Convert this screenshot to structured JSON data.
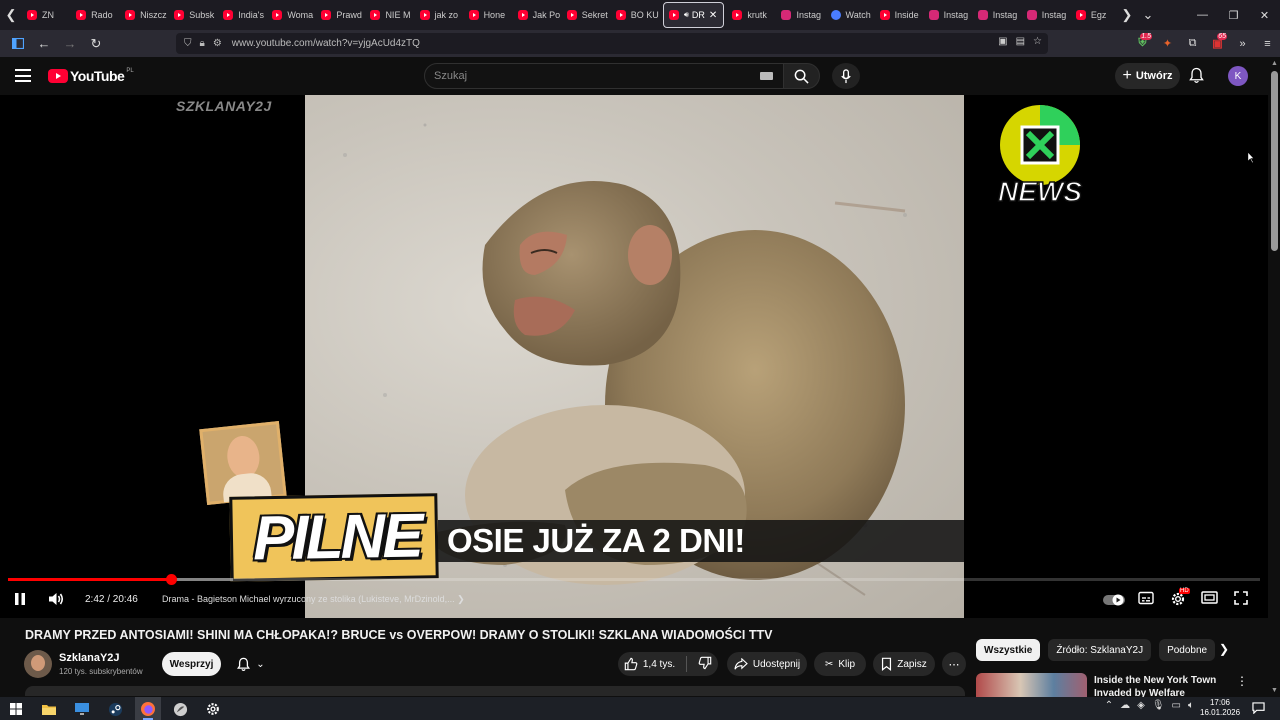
{
  "browser": {
    "tabs": [
      {
        "label": "ZN",
        "icon": "youtube-favicon"
      },
      {
        "label": "Rado",
        "icon": "youtube-favicon"
      },
      {
        "label": "Niszcz",
        "icon": "youtube-favicon"
      },
      {
        "label": "Subsk",
        "icon": "youtube-favicon"
      },
      {
        "label": "India's",
        "icon": "youtube-favicon"
      },
      {
        "label": "Woma",
        "icon": "youtube-favicon"
      },
      {
        "label": "Prawd",
        "icon": "youtube-favicon"
      },
      {
        "label": "NIE M",
        "icon": "youtube-favicon"
      },
      {
        "label": "jak zo",
        "icon": "youtube-favicon"
      },
      {
        "label": "Hone",
        "icon": "youtube-favicon"
      },
      {
        "label": "Jak Po",
        "icon": "youtube-favicon"
      },
      {
        "label": "Sekret",
        "icon": "youtube-favicon"
      },
      {
        "label": "BO KU",
        "icon": "youtube-favicon"
      },
      {
        "label": "DR",
        "icon": "youtube-favicon",
        "active": true
      },
      {
        "label": "krutk",
        "icon": "youtube-favicon"
      },
      {
        "label": "Instag",
        "icon": "instagram-favicon"
      },
      {
        "label": "Watch",
        "icon": "watch-favicon"
      },
      {
        "label": "Inside",
        "icon": "youtube-favicon"
      },
      {
        "label": "Instag",
        "icon": "instagram-favicon"
      },
      {
        "label": "Instag",
        "icon": "instagram-favicon"
      },
      {
        "label": "Instag",
        "icon": "instagram-favicon"
      },
      {
        "label": "Egz",
        "icon": "youtube-favicon"
      }
    ],
    "url": "www.youtube.com/watch?v=yjgAcUd4zTQ",
    "extension_badges": {
      "shield": "1.5",
      "ext2": "65"
    }
  },
  "youtube": {
    "logo_text": "YouTube",
    "logo_region": "PL",
    "search_placeholder": "Szukaj",
    "create_label": "Utwórz",
    "avatar_letter": "K",
    "accent_color": "#ff0033"
  },
  "player": {
    "watermark": "SZKLANAY2J",
    "news_logo_text": "NEWS",
    "pilne_text": "PILNE",
    "ticker_text": "OSIE JUŻ ZA 2 DNI!",
    "current_time": "2:42",
    "duration": "20:46",
    "time_display": "2:42 / 20:46",
    "progress_fraction": 0.13,
    "buffered_fraction": 0.18,
    "chapter": "Drama - Bagietson Michael wyrzucony ze stolika (Lukisteve, MrDzinold,...",
    "settings_badge": "HD"
  },
  "video": {
    "title": "DRAMY PRZED ANTOSIAMI! SHINI MA CHŁOPAKA!? BRUCE vs OVERPOW! DRAMY O STOLIKI! SZKLANA WIADOMOŚCI TTV",
    "channel_name": "SzklanaY2J",
    "subscribers": "120 tys. subskrybentów",
    "support_label": "Wesprzyj",
    "likes": "1,4 tys.",
    "share_label": "Udostępnij",
    "clip_label": "Klip",
    "save_label": "Zapisz"
  },
  "sidebar": {
    "chips": [
      "Wszystkie",
      "Źródło: SzklanaY2J",
      "Podobne"
    ],
    "recommended_title": "Inside the New York Town Invaded by Welfare Addicted"
  },
  "taskbar": {
    "time": "17:06",
    "date": "16.01.2026"
  }
}
